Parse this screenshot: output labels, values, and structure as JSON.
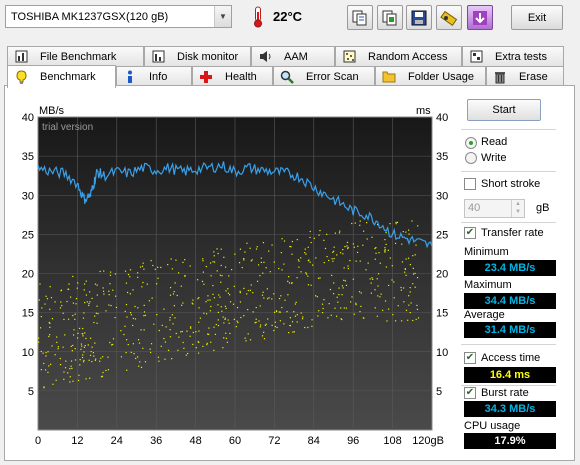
{
  "toolbar": {
    "drive_name": "TOSHIBA MK1237GSX",
    "drive_size": "(120 gB)",
    "temperature": "22°C",
    "buttons": [
      "copy-text-icon",
      "copy-screenshot-icon",
      "save-icon",
      "options-icon",
      "download-icon"
    ],
    "exit_label": "Exit"
  },
  "tabs_row1": [
    {
      "label": "File Benchmark",
      "icon": "file-benchmark-icon"
    },
    {
      "label": "Disk monitor",
      "icon": "disk-monitor-icon"
    },
    {
      "label": "AAM",
      "icon": "speaker-icon"
    },
    {
      "label": "Random Access",
      "icon": "random-access-icon"
    },
    {
      "label": "Extra tests",
      "icon": "extra-tests-icon"
    }
  ],
  "tabs_row2": [
    {
      "label": "Benchmark",
      "icon": "benchmark-icon"
    },
    {
      "label": "Info",
      "icon": "info-icon"
    },
    {
      "label": "Health",
      "icon": "health-icon"
    },
    {
      "label": "Error Scan",
      "icon": "error-scan-icon"
    },
    {
      "label": "Folder Usage",
      "icon": "folder-icon"
    },
    {
      "label": "Erase",
      "icon": "trash-icon"
    }
  ],
  "active_tab": "Benchmark",
  "graph": {
    "left_unit": "MB/s",
    "right_unit": "ms",
    "watermark": "trial version",
    "y_ticks": [
      5,
      10,
      15,
      20,
      25,
      30,
      35,
      40
    ],
    "x_ticks": [
      "0",
      "12",
      "24",
      "36",
      "48",
      "60",
      "72",
      "84",
      "96",
      "108",
      "120gB"
    ]
  },
  "chart_data": {
    "type": "line",
    "xlabel": "gB",
    "ylabel": "MB/s",
    "y2label": "ms",
    "xlim": [
      0,
      120
    ],
    "ylim": [
      0,
      40
    ],
    "grid": true,
    "series": [
      {
        "name": "Transfer rate",
        "color": "#3aa0e8",
        "x": [
          0,
          4,
          8,
          12,
          14,
          16,
          17,
          18,
          20,
          24,
          28,
          32,
          36,
          40,
          44,
          48,
          52,
          56,
          60,
          64,
          68,
          72,
          76,
          80,
          84,
          88,
          92,
          96,
          100,
          104,
          108,
          112,
          116,
          120
        ],
        "y": [
          33.5,
          33.0,
          32.8,
          31.5,
          29.5,
          30.0,
          31.5,
          33.0,
          32.5,
          33.0,
          32.8,
          33.5,
          33.2,
          33.5,
          33.0,
          33.3,
          33.5,
          33.8,
          33.0,
          33.5,
          33.2,
          33.0,
          32.8,
          32.3,
          31.0,
          30.0,
          29.0,
          28.0,
          27.5,
          26.5,
          25.0,
          24.5,
          24.0,
          23.5
        ]
      },
      {
        "name": "Access time",
        "color": "#f0f000",
        "type": "scatter",
        "x_range": [
          0,
          120
        ],
        "y_low_start": 5,
        "y_high_start": 19,
        "y_low_end": 14,
        "y_high_end": 27
      }
    ]
  },
  "panel": {
    "start_label": "Start",
    "read_label": "Read",
    "write_label": "Write",
    "mode": "Read",
    "short_stroke_label": "Short stroke",
    "short_stroke_checked": false,
    "stroke_value": "40",
    "stroke_unit": "gB",
    "transfer_rate_label": "Transfer rate",
    "transfer_rate_checked": true,
    "minimum_label": "Minimum",
    "minimum_value": "23.4 MB/s",
    "maximum_label": "Maximum",
    "maximum_value": "34.4 MB/s",
    "average_label": "Average",
    "average_value": "31.4 MB/s",
    "access_time_label": "Access time",
    "access_time_checked": true,
    "access_time_value": "16.4 ms",
    "burst_rate_label": "Burst rate",
    "burst_rate_checked": true,
    "burst_rate_value": "34.3 MB/s",
    "cpu_usage_label": "CPU usage",
    "cpu_usage_value": "17.9%"
  }
}
